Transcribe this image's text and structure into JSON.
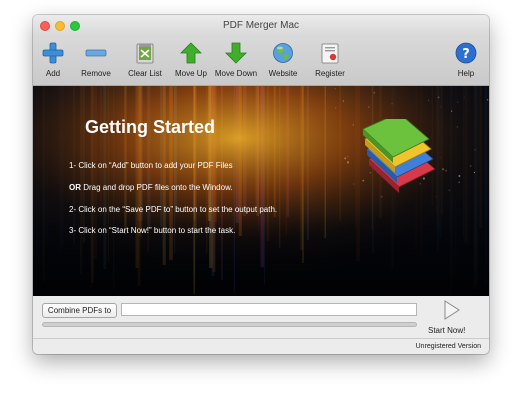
{
  "window": {
    "title": "PDF Merger Mac"
  },
  "toolbar": {
    "items": [
      {
        "label": "Add",
        "icon": "add-icon"
      },
      {
        "label": "Remove",
        "icon": "remove-icon"
      },
      {
        "label": "Clear List",
        "icon": "clear-list-icon"
      },
      {
        "label": "Move Up",
        "icon": "move-up-icon"
      },
      {
        "label": "Move Down",
        "icon": "move-down-icon"
      },
      {
        "label": "Website",
        "icon": "globe-icon"
      },
      {
        "label": "Register",
        "icon": "register-icon"
      },
      {
        "label": "Help",
        "icon": "help-icon"
      }
    ]
  },
  "banner": {
    "title": "Getting Started",
    "step1": "1- Click on “Add” button to add your PDF Files",
    "step_or_prefix": "OR",
    "step_or_text": " Drag and drop PDF files onto the Window.",
    "step2": "2- Click on the “Save PDF to” button to set the output path.",
    "step3": "3- Click on “Start Now!” button to start the task."
  },
  "bottom": {
    "combine_label": "Combine PDFs to",
    "path_value": "",
    "progress": 0,
    "start_label": "Start Now!",
    "status": "Unregistered Version"
  },
  "colors": {
    "add": "#3a8fd8",
    "remove": "#6aa7dc",
    "arrow_green": "#3fae2a",
    "help": "#2d6fd1"
  }
}
